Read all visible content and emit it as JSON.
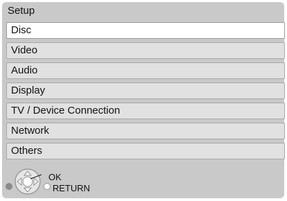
{
  "window": {
    "title": "Setup"
  },
  "menu": {
    "items": [
      {
        "label": "Disc",
        "selected": true
      },
      {
        "label": "Video",
        "selected": false
      },
      {
        "label": "Audio",
        "selected": false
      },
      {
        "label": "Display",
        "selected": false
      },
      {
        "label": "TV / Device Connection",
        "selected": false
      },
      {
        "label": "Network",
        "selected": false
      },
      {
        "label": "Others",
        "selected": false
      }
    ]
  },
  "footer": {
    "ok_label": "OK",
    "return_label": "RETURN",
    "icons": [
      "dpad-icon",
      "return-button-icon"
    ]
  },
  "colors": {
    "panel_bg": "#c9c9c9",
    "item_bg": "#e1e1e1",
    "selected_bg": "#ffffff"
  }
}
